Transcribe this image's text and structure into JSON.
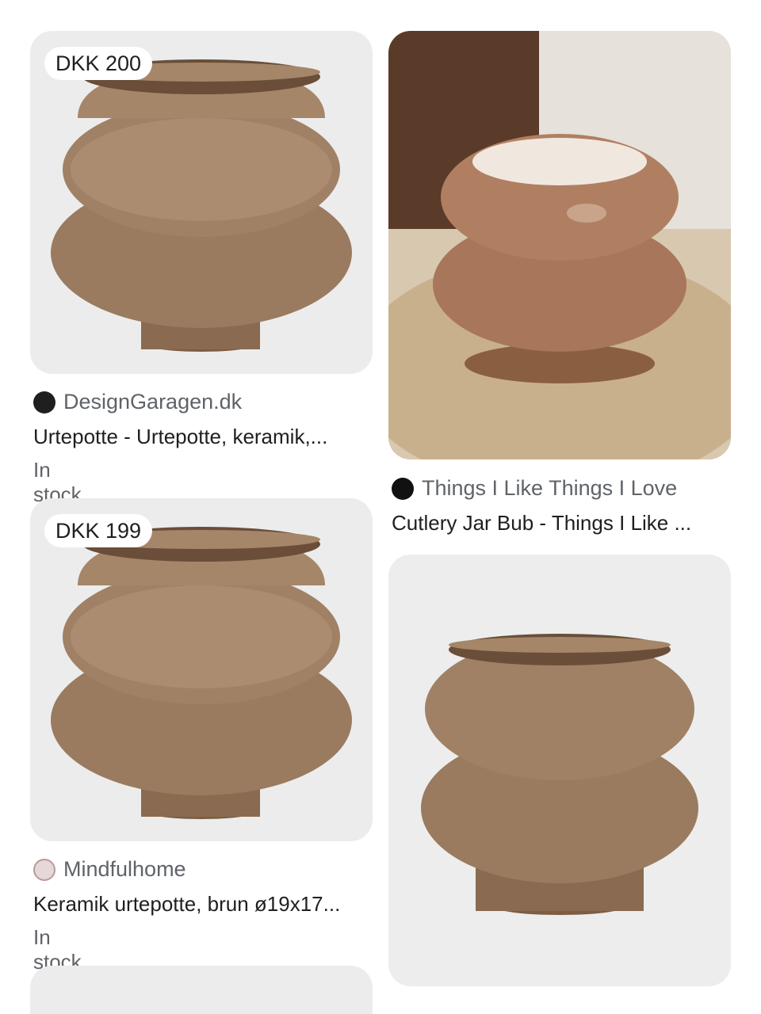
{
  "results": [
    {
      "price": "DKK 200",
      "source": "DesignGaragen.dk",
      "title": "Urtepotte - Urtepotte, keramik,...",
      "stock": "In stock",
      "icon": "store-logo-icon"
    },
    {
      "source": "Things I Like Things I Love",
      "title": "Cutlery Jar Bub - Things I Like ...",
      "icon": "store-logo-icon"
    },
    {
      "price": "DKK 199",
      "source": "Mindfulhome",
      "title": "Keramik urtepotte, brun ø19x17...",
      "stock": "In stock",
      "icon": "flower-logo-icon"
    },
    {
      "image": "product-image"
    }
  ],
  "colors": {
    "pot": "#9c7a5e",
    "pot_dark": "#7a5a40",
    "pot_light": "#b3937a",
    "card_bg": "#eeeeee"
  }
}
